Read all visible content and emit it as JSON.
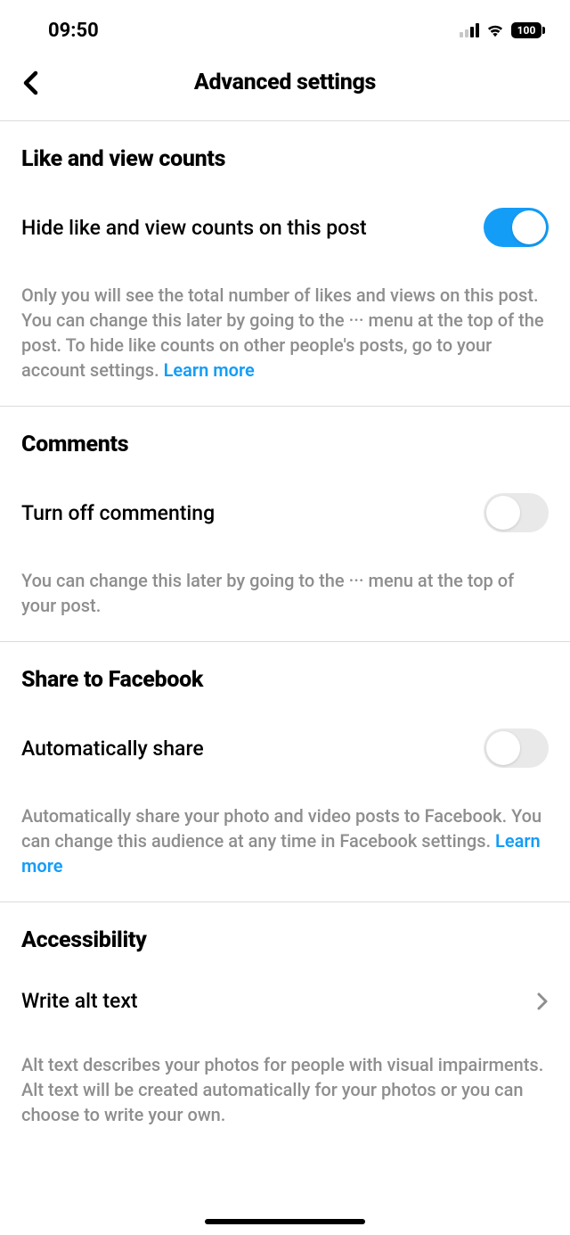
{
  "statusBar": {
    "time": "09:50",
    "batteryLevel": "100"
  },
  "header": {
    "title": "Advanced settings"
  },
  "sections": {
    "likes": {
      "title": "Like and view counts",
      "toggleLabel": "Hide like and view counts on this post",
      "description": "Only you will see the total number of likes and views on this post. You can change this later by going to the ··· menu at the top of the post. To hide like counts on other people's posts, go to your account settings. ",
      "learnMore": "Learn more"
    },
    "comments": {
      "title": "Comments",
      "toggleLabel": "Turn off commenting",
      "description": "You can change this later by going to the ··· menu at the top of your post."
    },
    "facebook": {
      "title": "Share to Facebook",
      "toggleLabel": "Automatically share",
      "description": "Automatically share your photo and video posts to Facebook. You can change this audience at any time in Facebook settings. ",
      "learnMore": "Learn more"
    },
    "accessibility": {
      "title": "Accessibility",
      "rowLabel": "Write alt text",
      "description": "Alt text describes your photos for people with visual impairments. Alt text will be created automatically for your photos or you can choose to write your own."
    }
  }
}
